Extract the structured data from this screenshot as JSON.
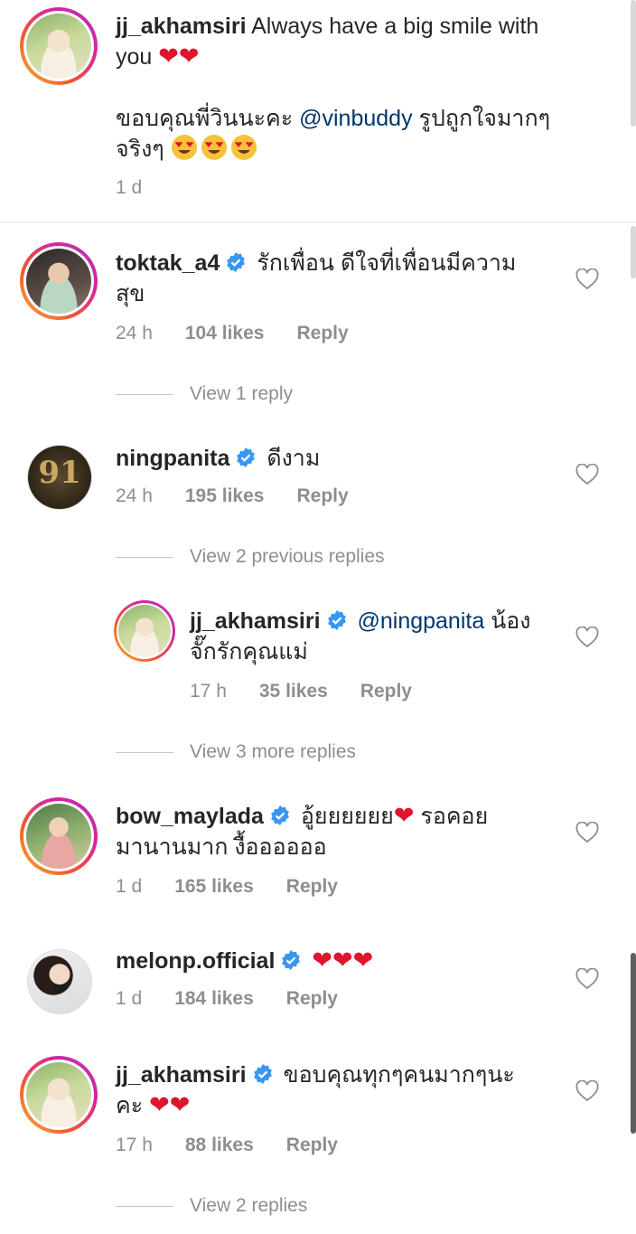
{
  "caption": {
    "username": "jj_akhamsiri",
    "text_line1": "Always have a big smile with",
    "text_line2": "you",
    "hearts": "❤❤",
    "thai_line1_pre": "ขอบคุณพี่วินนะคะ",
    "mention": "@vinbuddy",
    "thai_line1_post": "รูปถูกใจมากๆ",
    "thai_line2": "จริงๆ",
    "time": "1 d"
  },
  "comments": [
    {
      "username": "toktak_a4",
      "verified": true,
      "text_line1": "รักเพื่อน ดีใจที่เพื่อนมีความ",
      "text_line2": "สุข",
      "time": "24 h",
      "likes": "104 likes",
      "reply_label": "Reply",
      "view_replies": "View 1 reply"
    },
    {
      "username": "ningpanita",
      "verified": true,
      "avatar_text": "91",
      "text_line1": "ดีงาม",
      "time": "24 h",
      "likes": "195 likes",
      "reply_label": "Reply",
      "view_replies": "View 2 previous replies"
    },
    {
      "username": "jj_akhamsiri",
      "verified": true,
      "mention": "@ningpanita",
      "text_line1_post": "น้อง",
      "text_line2": "จั๊กรักคุณแม่",
      "time": "17 h",
      "likes": "35 likes",
      "reply_label": "Reply",
      "view_replies": "View 3 more replies"
    },
    {
      "username": "bow_maylada",
      "verified": true,
      "text_line1_pre": "อู้ยยยยยย",
      "heart": "❤",
      "text_line1_post": "รอคอย",
      "text_line2": "มานานมาก งื้ออออออ",
      "time": "1 d",
      "likes": "165 likes",
      "reply_label": "Reply"
    },
    {
      "username": "melonp.official",
      "verified": true,
      "hearts": "❤❤❤",
      "time": "1 d",
      "likes": "184 likes",
      "reply_label": "Reply"
    },
    {
      "username": "jj_akhamsiri",
      "verified": true,
      "text_line1": "ขอบคุณทุกๆคนมากๆนะ",
      "text_line2_pre": "คะ",
      "hearts": "❤❤",
      "time": "17 h",
      "likes": "88 likes",
      "reply_label": "Reply",
      "view_replies": "View 2 replies"
    }
  ],
  "colors": {
    "text": "#262626",
    "secondary": "#8e8e8e",
    "mention": "#00376b",
    "verified": "#3897f0",
    "heart": "#e0142d"
  }
}
